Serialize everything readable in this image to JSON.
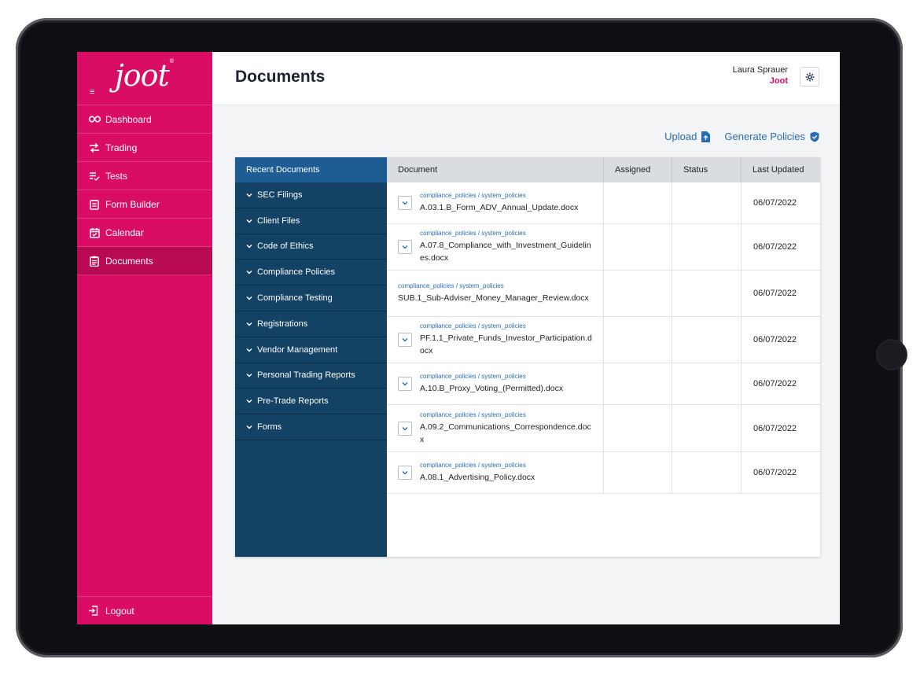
{
  "app": {
    "logo": "joot"
  },
  "sidebar": {
    "items": [
      {
        "label": "Dashboard",
        "icon": "infinity-icon"
      },
      {
        "label": "Trading",
        "icon": "swap-icon"
      },
      {
        "label": "Tests",
        "icon": "checklist-icon"
      },
      {
        "label": "Form Builder",
        "icon": "form-icon"
      },
      {
        "label": "Calendar",
        "icon": "calendar-icon"
      },
      {
        "label": "Documents",
        "icon": "clipboard-icon",
        "active": true
      }
    ],
    "logout": "Logout"
  },
  "header": {
    "title": "Documents",
    "user_name": "Laura Sprauer",
    "user_org": "Joot"
  },
  "actions": {
    "upload": "Upload",
    "generate": "Generate Policies"
  },
  "folders": {
    "header": "Recent Documents",
    "items": [
      "SEC Filings",
      "Client Files",
      "Code of Ethics",
      "Compliance Policies",
      "Compliance Testing",
      "Registrations",
      "Vendor Management",
      "Personal Trading Reports",
      "Pre-Trade Reports",
      "Forms"
    ]
  },
  "table": {
    "columns": [
      "Document",
      "Assigned",
      "Status",
      "Last Updated"
    ],
    "rows": [
      {
        "path": "compliance_policies / system_policies",
        "name": "A.03.1.B_Form_ADV_Annual_Update.docx",
        "assigned": "",
        "status": "",
        "updated": "06/07/2022"
      },
      {
        "path": "compliance_policies / system_policies",
        "name": "A.07.8_Compliance_with_Investment_Guidelines.docx",
        "assigned": "",
        "status": "",
        "updated": "06/07/2022"
      },
      {
        "path": "compliance_policies / system_policies",
        "name": "SUB.1_Sub-Adviser_Money_Manager_Review.docx",
        "assigned": "",
        "status": "",
        "updated": "06/07/2022"
      },
      {
        "path": "compliance_policies / system_policies",
        "name": "PF.1.1_Private_Funds_Investor_Participation.docx",
        "assigned": "",
        "status": "",
        "updated": "06/07/2022"
      },
      {
        "path": "compliance_policies / system_policies",
        "name": "A.10.B_Proxy_Voting_(Permitted).docx",
        "assigned": "",
        "status": "",
        "updated": "06/07/2022"
      },
      {
        "path": "compliance_policies / system_policies",
        "name": "A.09.2_Communications_Correspondence.docx",
        "assigned": "",
        "status": "",
        "updated": "06/07/2022"
      },
      {
        "path": "compliance_policies / system_policies",
        "name": "A.08.1_Advertising_Policy.docx",
        "assigned": "",
        "status": "",
        "updated": "06/07/2022"
      }
    ]
  },
  "colors": {
    "brand": "#d90d63",
    "navy": "#134265",
    "accent_blue": "#2a6cb0"
  }
}
